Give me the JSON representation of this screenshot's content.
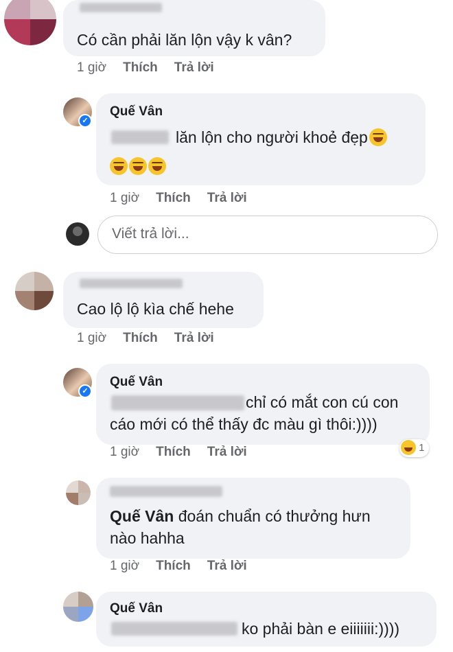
{
  "comments": [
    {
      "text": "Có cần phải lăn lộn vậy k vân?",
      "time": "1 giờ",
      "like": "Thích",
      "reply": "Trả lời"
    },
    {
      "name": "Quế Vân",
      "text": "lăn lộn cho người khoẻ đẹp",
      "emoji": "rolling-on-floor-laughing",
      "time": "1 giờ",
      "like": "Thích",
      "reply": "Trả lời"
    },
    {
      "text": "Cao lộ lộ kìa chế hehe",
      "time": "1 giờ",
      "like": "Thích",
      "reply": "Trả lời"
    },
    {
      "name": "Quế Vân",
      "line1": "chỉ có mắt con cú con",
      "line2": "cáo mới có thể thấy đc màu gì thôi:))))",
      "time": "1 giờ",
      "like": "Thích",
      "reply": "Trả lời",
      "reaction_count": "1"
    },
    {
      "mention": "Quế Vân",
      "line1": "đoán chuẩn có thưởng hưn",
      "line2": "nào hahha",
      "time": "1 giờ",
      "like": "Thích",
      "reply": "Trả lời"
    },
    {
      "name": "Quế Vân",
      "text": "ko phải bàn e eiiiiiii:))))"
    }
  ],
  "reply_box": {
    "placeholder": "Viết trả lời..."
  },
  "colors": {
    "bubble": "#f0f2f5",
    "meta": "#65676b",
    "verified": "#1877f2"
  }
}
